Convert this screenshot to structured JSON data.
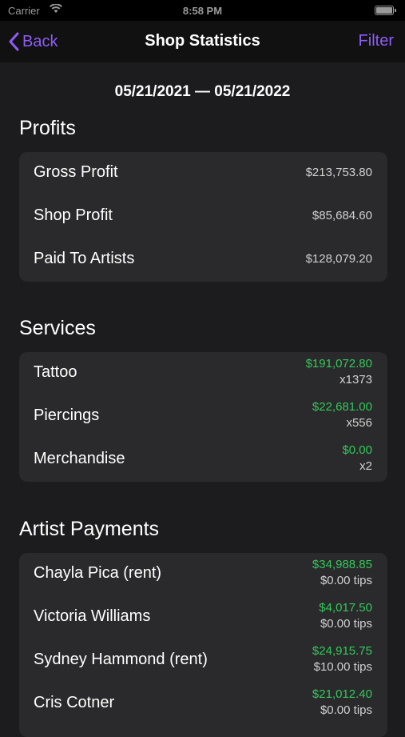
{
  "status_bar": {
    "carrier": "Carrier",
    "time": "8:58 PM"
  },
  "nav": {
    "back_label": "Back",
    "title": "Shop Statistics",
    "filter_label": "Filter"
  },
  "date_range": "05/21/2021 — 05/21/2022",
  "profits": {
    "title": "Profits",
    "rows": [
      {
        "label": "Gross Profit",
        "value": "$213,753.80"
      },
      {
        "label": "Shop Profit",
        "value": "$85,684.60"
      },
      {
        "label": "Paid To Artists",
        "value": "$128,079.20"
      }
    ]
  },
  "services": {
    "title": "Services",
    "rows": [
      {
        "label": "Tattoo",
        "amount": "$191,072.80",
        "count": "x1373"
      },
      {
        "label": "Piercings",
        "amount": "$22,681.00",
        "count": "x556"
      },
      {
        "label": "Merchandise",
        "amount": "$0.00",
        "count": "x2"
      }
    ]
  },
  "artist_payments": {
    "title": "Artist Payments",
    "rows": [
      {
        "label": "Chayla Pica (rent)",
        "amount": "$34,988.85",
        "tips": "$0.00 tips"
      },
      {
        "label": "Victoria Williams",
        "amount": "$4,017.50",
        "tips": "$0.00 tips"
      },
      {
        "label": "Sydney Hammond (rent)",
        "amount": "$24,915.75",
        "tips": "$10.00 tips"
      },
      {
        "label": "Cris Cotner",
        "amount": "$21,012.40",
        "tips": "$0.00 tips"
      }
    ]
  },
  "colors": {
    "accent": "#8f5cf7",
    "positive": "#34c759",
    "background": "#1c1c1e",
    "card": "#2a2a2c"
  }
}
